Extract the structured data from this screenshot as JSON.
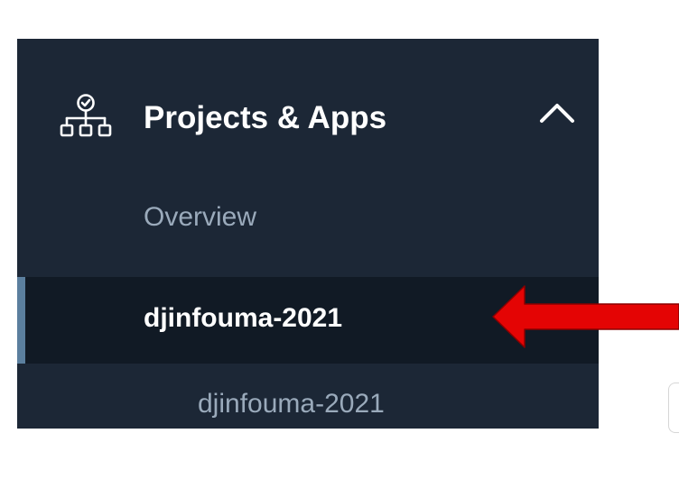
{
  "sidebar": {
    "section": {
      "title": "Projects & Apps",
      "icon": "sitemap-check-icon",
      "collapse_icon": "chevron-up-icon",
      "expanded": true
    },
    "items": [
      {
        "label": "Overview",
        "active": false
      },
      {
        "label": "djinfouma-2021",
        "active": true
      },
      {
        "label": "djinfouma-2021",
        "active": false,
        "level": 2
      }
    ]
  },
  "annotation": {
    "icon": "red-arrow-left-icon",
    "color": "#e40404"
  },
  "colors": {
    "sidebar_bg": "#1c2736",
    "active_bg": "#111a25",
    "active_indicator": "#5b7f9e",
    "muted_text": "#9aaabb",
    "text": "#ffffff"
  }
}
